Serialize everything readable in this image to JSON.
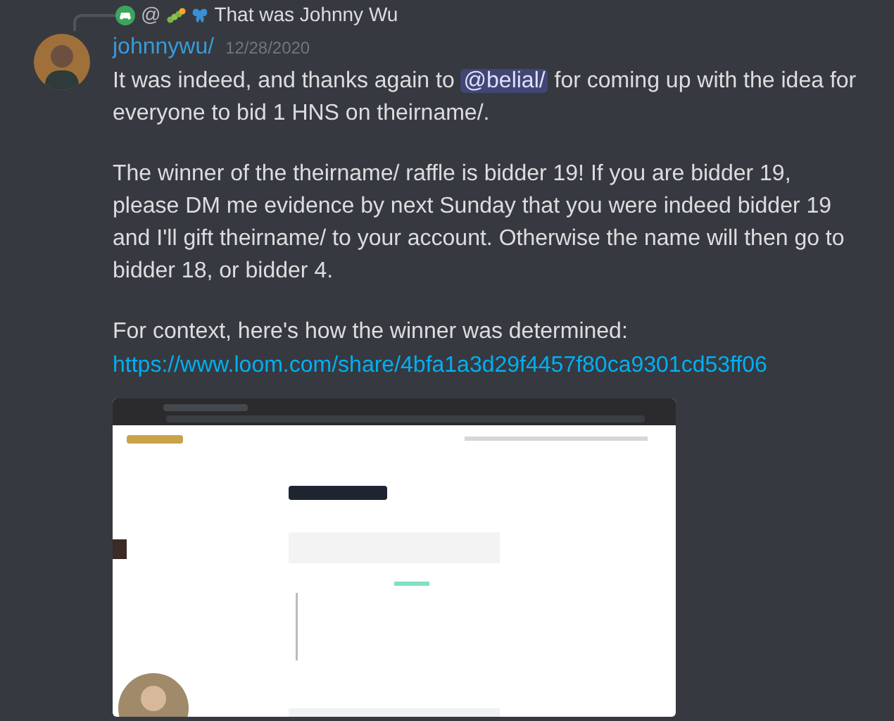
{
  "reply": {
    "mention": "@",
    "text": "That was Johnny Wu"
  },
  "message": {
    "author": "johnnywu/",
    "timestamp": "12/28/2020",
    "paragraphs": [
      {
        "parts": [
          {
            "kind": "text",
            "text": "It was indeed, and thanks again to "
          },
          {
            "kind": "mention",
            "text": "@belial/"
          },
          {
            "kind": "text",
            "text": " for coming up with the idea for everyone to bid 1 HNS on theirname/."
          }
        ]
      },
      {
        "parts": [
          {
            "kind": "text",
            "text": "The winner of the theirname/ raffle is bidder 19! If you are bidder 19, please DM me evidence by next Sunday that you were indeed bidder 19 and I'll gift theirname/ to your account. Otherwise the name will then go to bidder 18, or bidder 4."
          }
        ]
      },
      {
        "parts": [
          {
            "kind": "text",
            "text": "For context, here's how the winner was determined:"
          }
        ]
      }
    ],
    "link": "https://www.loom.com/share/4bfa1a3d29f4457f80ca9301cd53ff06"
  }
}
